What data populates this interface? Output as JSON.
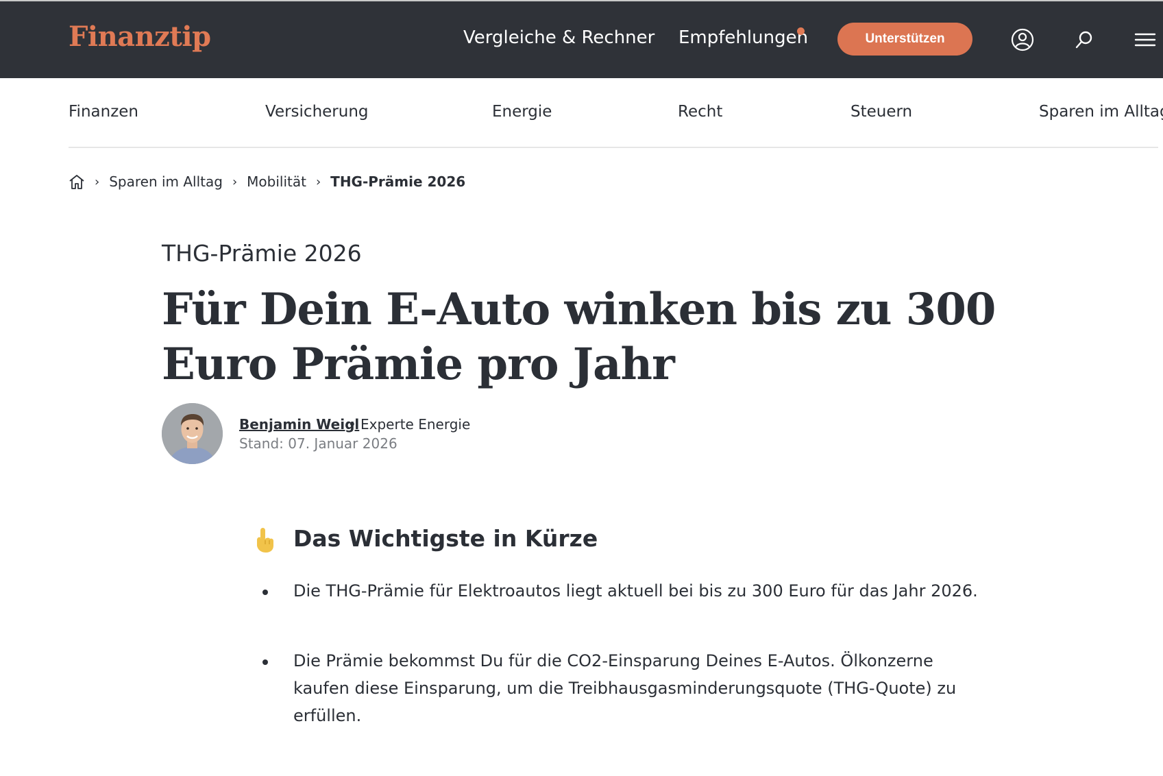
{
  "header": {
    "logo": "Finanztip",
    "nav": [
      {
        "label": "Vergleiche & Rechner"
      },
      {
        "label": "Empfehlungen"
      }
    ],
    "support_label": "Unterstützen",
    "icons": [
      "user-icon",
      "search-icon",
      "menu-icon"
    ]
  },
  "categories": [
    {
      "label": "Finanzen"
    },
    {
      "label": "Versicherung"
    },
    {
      "label": "Energie"
    },
    {
      "label": "Recht"
    },
    {
      "label": "Steuern"
    },
    {
      "label": "Sparen im Alltag"
    }
  ],
  "breadcrumb": {
    "home_icon": "home-icon",
    "items": [
      {
        "label": "Sparen im Alltag"
      },
      {
        "label": "Mobilität"
      },
      {
        "label": "THG-Prämie 2026"
      }
    ],
    "separator": "›"
  },
  "article": {
    "kicker": "THG-Prämie 2026",
    "headline": "Für Dein E-Auto winken bis zu 300 Euro Prämie pro Jahr",
    "author": {
      "name": "Benjamin Weigl",
      "separator": "•",
      "role": "Experte Energie",
      "date": "Stand: 07. Januar 2026"
    }
  },
  "summary": {
    "icon": "pointing-hand-icon",
    "title": "Das Wichtigste in Kürze",
    "bullets": [
      "Die THG-Prämie für Elektroautos liegt aktuell  bei bis zu 300 Euro für das Jahr 2026.",
      "Die Prämie bekommst Du für die CO2-Einsparung Deines E-Autos. Ölkonzerne kaufen diese Einsparung, um die Treibhausgasminderungsquote (THG-Quote) zu erfüllen."
    ]
  },
  "colors": {
    "topbar": "#2f3238",
    "accent": "#dc7552",
    "text": "#2b2f36",
    "muted": "#7a7d82"
  }
}
